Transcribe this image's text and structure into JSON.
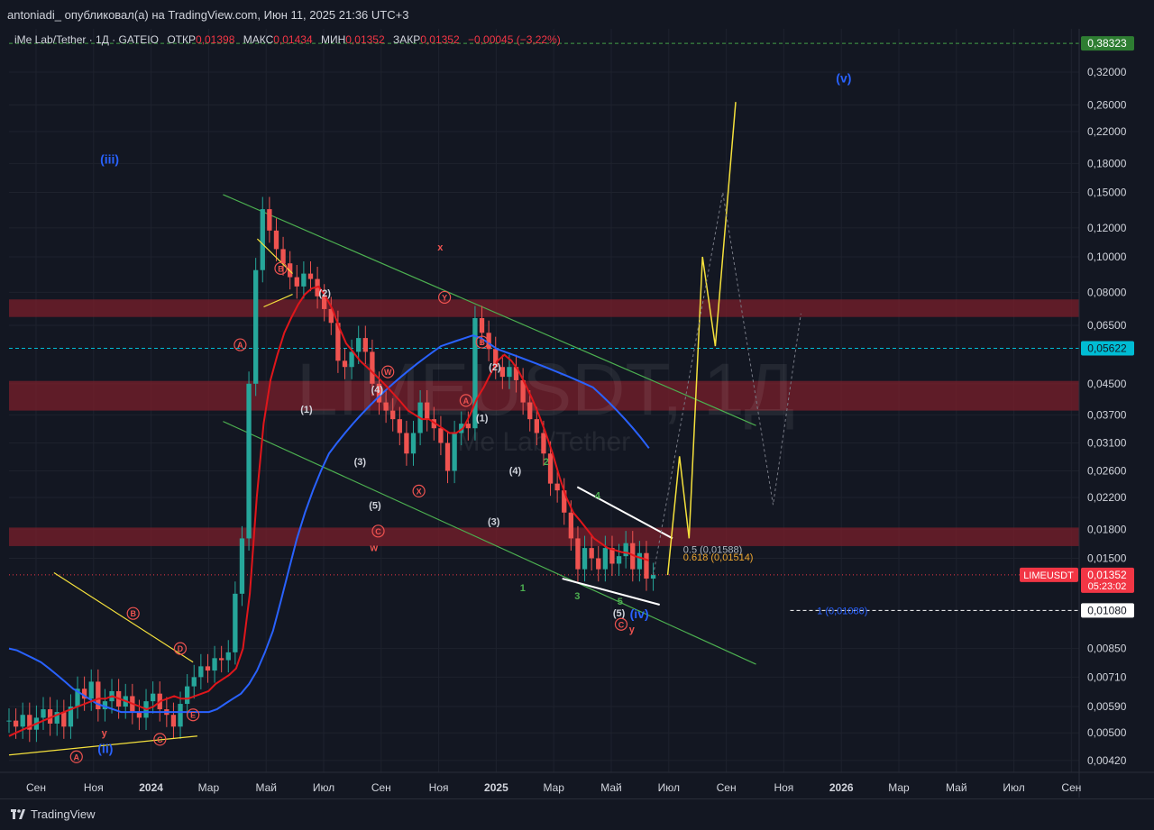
{
  "header": {
    "author_line": "antoniadi_ опубликовал(а) на TradingView.com, Июн 11, 2025 21:36 UTC+3"
  },
  "legend": {
    "symbol": "iMe Lab/Tether · 1Д · GATEIO",
    "open_label": "ОТКР",
    "open_value": "0,01398",
    "high_label": "МАКС",
    "high_value": "0,01434",
    "low_label": "МИН",
    "low_value": "0,01352",
    "close_label": "ЗАКР",
    "close_value": "0,01352",
    "change": "−0,00045 (−3,22%)"
  },
  "watermark": {
    "main": "LIMEUSDT, 1Д",
    "sub": "iMe Lab/Tether"
  },
  "footer": {
    "brand": "TradingView"
  },
  "colors": {
    "background": "#131722",
    "grid": "#1e222d",
    "up": "#26a69a",
    "down": "#ef5350",
    "ma_fast": "#e0161b",
    "ma_slow": "#2962ff",
    "channel": "#4caf50",
    "projection": "#f5e13c",
    "zone": "#7a1f2b",
    "accent_teal": "#00bcd4",
    "accent_green": "#43a047",
    "price_tag": "#f23645"
  },
  "chart_data": {
    "type": "candlestick",
    "scale": "log",
    "ylim": [
      0.0039,
      0.42
    ],
    "y_ticks": [
      "0,32000",
      "0,26000",
      "0,22000",
      "0,18000",
      "0,15000",
      "0,12000",
      "0,10000",
      "0,08000",
      "0,06500",
      "0,04500",
      "0,03700",
      "0,03100",
      "0,02600",
      "0,02200",
      "0,01800",
      "0,01500",
      "0,00850",
      "0,00710",
      "0,00590",
      "0,00500",
      "0,00420"
    ],
    "x_labels": [
      "Сен",
      "Ноя",
      "2024",
      "Мар",
      "Май",
      "Июл",
      "Сен",
      "Ноя",
      "2025",
      "Мар",
      "Май",
      "Июл",
      "Сен",
      "Ноя",
      "2026",
      "Мар",
      "Май",
      "Июл",
      "Сен"
    ],
    "price_tags": [
      {
        "value": "0,38323",
        "level": 0.38323,
        "style": "green"
      },
      {
        "value": "0,05622",
        "level": 0.05622,
        "style": "teal"
      },
      {
        "value": "0,01352",
        "level": 0.01352,
        "style": "red",
        "countdown": "05:23:02",
        "label": "LIMEUSDT"
      },
      {
        "value": "0,01080",
        "level": 0.0108,
        "style": "white"
      }
    ],
    "fib_labels": [
      {
        "text": "0.5 (0,01588)",
        "level": 0.01588
      },
      {
        "text": "0.618 (0,01514)",
        "level": 0.01514
      },
      {
        "text": "1 (0,01080)",
        "level": 0.0108
      }
    ],
    "resistance_zones": [
      [
        0.0685,
        0.0765
      ],
      [
        0.038,
        0.0458
      ],
      [
        0.0162,
        0.0182
      ]
    ],
    "closes": [
      0.0054,
      0.0052,
      0.0056,
      0.0051,
      0.0055,
      0.0058,
      0.0053,
      0.0057,
      0.0052,
      0.0059,
      0.0066,
      0.0062,
      0.0069,
      0.0058,
      0.0061,
      0.0065,
      0.0059,
      0.0063,
      0.0057,
      0.0055,
      0.0061,
      0.0064,
      0.0058,
      0.0056,
      0.0052,
      0.006,
      0.0067,
      0.0071,
      0.0076,
      0.0074,
      0.008,
      0.0079,
      0.0083,
      0.012,
      0.017,
      0.045,
      0.092,
      0.135,
      0.118,
      0.105,
      0.096,
      0.088,
      0.083,
      0.09,
      0.087,
      0.078,
      0.072,
      0.066,
      0.052,
      0.05,
      0.055,
      0.06,
      0.055,
      0.045,
      0.04,
      0.038,
      0.036,
      0.033,
      0.029,
      0.033,
      0.04,
      0.036,
      0.034,
      0.031,
      0.026,
      0.033,
      0.035,
      0.034,
      0.068,
      0.062,
      0.056,
      0.05,
      0.047,
      0.05,
      0.046,
      0.04,
      0.036,
      0.033,
      0.029,
      0.024,
      0.023,
      0.02,
      0.017,
      0.014,
      0.016,
      0.015,
      0.014,
      0.016,
      0.0145,
      0.0152,
      0.0165,
      0.014,
      0.0155,
      0.0132,
      0.0135
    ],
    "ma_fast": [
      0.0049,
      0.005,
      0.0051,
      0.0052,
      0.0053,
      0.0054,
      0.0055,
      0.0056,
      0.0057,
      0.0058,
      0.0059,
      0.006,
      0.0061,
      0.0062,
      0.0062,
      0.0063,
      0.0062,
      0.0061,
      0.006,
      0.0059,
      0.0058,
      0.0059,
      0.0061,
      0.0062,
      0.0063,
      0.0062,
      0.0062,
      0.0063,
      0.0064,
      0.0065,
      0.0068,
      0.007,
      0.0072,
      0.0075,
      0.0085,
      0.012,
      0.022,
      0.035,
      0.046,
      0.054,
      0.062,
      0.068,
      0.074,
      0.079,
      0.082,
      0.083,
      0.078,
      0.072,
      0.064,
      0.058,
      0.055,
      0.052,
      0.05,
      0.048,
      0.046,
      0.044,
      0.042,
      0.04,
      0.038,
      0.037,
      0.036,
      0.036,
      0.035,
      0.034,
      0.033,
      0.033,
      0.034,
      0.037,
      0.041,
      0.044,
      0.048,
      0.052,
      0.054,
      0.052,
      0.049,
      0.045,
      0.041,
      0.037,
      0.033,
      0.029,
      0.025,
      0.022,
      0.02,
      0.019,
      0.018,
      0.017,
      0.0165,
      0.016,
      0.0158,
      0.0156,
      0.0155,
      0.0152,
      0.015,
      0.0148
    ],
    "ma_slow": [
      0.0085,
      0.0084,
      0.0082,
      0.008,
      0.0078,
      0.0075,
      0.0072,
      0.0069,
      0.0066,
      0.0064,
      0.0062,
      0.006,
      0.0059,
      0.0058,
      0.0057,
      0.0057,
      0.0057,
      0.0057,
      0.0057,
      0.0057,
      0.0057,
      0.0057,
      0.0057,
      0.0057,
      0.0057,
      0.0057,
      0.0058,
      0.006,
      0.0062,
      0.0064,
      0.0068,
      0.0074,
      0.0083,
      0.0095,
      0.0115,
      0.014,
      0.017,
      0.02,
      0.023,
      0.026,
      0.029,
      0.031,
      0.033,
      0.035,
      0.037,
      0.039,
      0.041,
      0.043,
      0.045,
      0.047,
      0.049,
      0.051,
      0.053,
      0.055,
      0.057,
      0.058,
      0.059,
      0.06,
      0.061,
      0.06,
      0.058,
      0.056,
      0.055,
      0.054,
      0.053,
      0.052,
      0.051,
      0.05,
      0.049,
      0.048,
      0.047,
      0.046,
      0.045,
      0.044,
      0.042,
      0.04,
      0.038,
      0.036,
      0.034,
      0.032,
      0.03
    ],
    "projection_path": [
      [
        0.0135,
        0.0135
      ],
      [
        0.0245,
        0.0285
      ],
      [
        0.0335,
        0.017
      ],
      [
        0.046,
        0.1
      ],
      [
        0.058,
        0.057
      ],
      [
        0.077,
        0.265
      ]
    ],
    "waves": [
      {
        "text": "(iii)",
        "color": "blue",
        "x": 0.094,
        "y": 0.18
      },
      {
        "text": "(ii)",
        "color": "blue",
        "x": 0.09,
        "y": 0.0044
      },
      {
        "text": "(iv)",
        "color": "blue",
        "x": 0.589,
        "y": 0.0103
      },
      {
        "text": "(v)",
        "color": "blue",
        "x": 0.78,
        "y": 0.3
      },
      {
        "text": "y",
        "color": "red",
        "x": 0.089,
        "y": 0.0049
      },
      {
        "text": "x",
        "color": "red",
        "x": 0.403,
        "y": 0.104
      },
      {
        "text": "w",
        "color": "red",
        "x": 0.341,
        "y": 0.0157
      },
      {
        "text": "y",
        "color": "red",
        "x": 0.582,
        "y": 0.0094
      },
      {
        "text": "(2)",
        "color": "white",
        "x": 0.295,
        "y": 0.078
      },
      {
        "text": "(1)",
        "color": "white",
        "x": 0.278,
        "y": 0.0375
      },
      {
        "text": "(4)",
        "color": "white",
        "x": 0.344,
        "y": 0.0425
      },
      {
        "text": "(3)",
        "color": "white",
        "x": 0.328,
        "y": 0.027
      },
      {
        "text": "(5)",
        "color": "white",
        "x": 0.342,
        "y": 0.0205
      },
      {
        "text": "(2)",
        "color": "white",
        "x": 0.454,
        "y": 0.049
      },
      {
        "text": "(1)",
        "color": "white",
        "x": 0.442,
        "y": 0.0355
      },
      {
        "text": "(4)",
        "color": "white",
        "x": 0.473,
        "y": 0.0255
      },
      {
        "text": "(3)",
        "color": "white",
        "x": 0.453,
        "y": 0.0185
      },
      {
        "text": "(5)",
        "color": "white",
        "x": 0.57,
        "y": 0.0104
      },
      {
        "text": "1",
        "color": "green",
        "x": 0.48,
        "y": 0.0122
      },
      {
        "text": "2",
        "color": "green",
        "x": 0.502,
        "y": 0.027
      },
      {
        "text": "3",
        "color": "green",
        "x": 0.531,
        "y": 0.0116
      },
      {
        "text": "4",
        "color": "green",
        "x": 0.55,
        "y": 0.0218
      },
      {
        "text": "5",
        "color": "green",
        "x": 0.571,
        "y": 0.0112
      }
    ],
    "circled": [
      {
        "text": "A",
        "x": 0.063,
        "y": 0.0043
      },
      {
        "text": "B",
        "x": 0.116,
        "y": 0.0106
      },
      {
        "text": "C",
        "x": 0.141,
        "y": 0.0048
      },
      {
        "text": "D",
        "x": 0.16,
        "y": 0.0085
      },
      {
        "text": "E",
        "x": 0.172,
        "y": 0.0056
      },
      {
        "text": "A",
        "x": 0.216,
        "y": 0.0575
      },
      {
        "text": "B",
        "x": 0.254,
        "y": 0.093
      },
      {
        "text": "W",
        "x": 0.354,
        "y": 0.0485
      },
      {
        "text": "X",
        "x": 0.383,
        "y": 0.0229
      },
      {
        "text": "C",
        "x": 0.345,
        "y": 0.0178
      },
      {
        "text": "Y",
        "x": 0.407,
        "y": 0.0775
      },
      {
        "text": "A",
        "x": 0.427,
        "y": 0.0405
      },
      {
        "text": "B",
        "x": 0.442,
        "y": 0.0585
      },
      {
        "text": "C",
        "x": 0.572,
        "y": 0.0099
      }
    ]
  }
}
